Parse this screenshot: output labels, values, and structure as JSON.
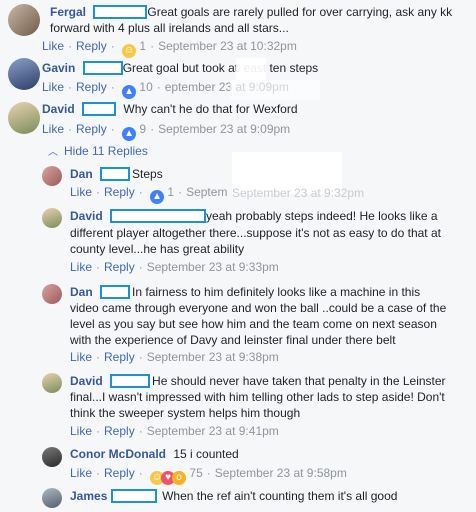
{
  "comments": [
    {
      "name": "Fergal",
      "text1": "Great goals are rarely pulled for over carrying, ask any kk",
      "text2": "forward with 4 plus all irelands and all stars...",
      "like": "Like",
      "reply": "Reply",
      "count": "1",
      "time": "September 23 at 10:32pm"
    },
    {
      "name": "Gavin",
      "text1": "Great goal but took at",
      "text1b": "east ten steps",
      "like": "Like",
      "reply": "Reply",
      "count": "10",
      "time": "September 23 at 9:09pm",
      "time_partial": "eptember 23 at 9:09pm"
    },
    {
      "name": "David",
      "text1": "Why can't he do that for Wexford",
      "like": "Like",
      "reply": "Reply",
      "count": "9",
      "time": "September 23 at 9:09pm"
    }
  ],
  "hide_replies": "Hide 11 Replies",
  "replies": [
    {
      "name": "Dan",
      "text1": "Steps",
      "like": "Like",
      "reply": "Reply",
      "count": "1",
      "time": "September 23 at 9:32pm",
      "time_partial": "Septem"
    },
    {
      "name": "David",
      "text1": "yeah probably steps indeed! He looks like a",
      "text2": "different player altogether there...suppose it's not as easy to do that at",
      "text3": "county level...he has great ability",
      "like": "Like",
      "reply": "Reply",
      "time": "September 23 at 9:33pm"
    },
    {
      "name": "Dan",
      "text1": "In fairness to him definitely looks like a machine in this",
      "text2": "video came through everyone and won the ball ..could be a case of the",
      "text3": "level as you say but see how him and the team come on next season",
      "text4": "with the experience of Davy and leinster final under there belt",
      "like": "Like",
      "reply": "Reply",
      "time": "September 23 at 9:38pm"
    },
    {
      "name": "David",
      "text1": "He should never have taken that penalty in the Leinster",
      "text2": "final...I wasn't impressed with him telling other lads to step aside! Don't",
      "text3": "think the sweeper system helps him though",
      "like": "Like",
      "reply": "Reply",
      "time": "September 23 at 9:41pm"
    },
    {
      "name": "Conor McDonald",
      "text1": "15 i counted",
      "like": "Like",
      "reply": "Reply",
      "count": "75",
      "time": "September 23 at 9:58pm"
    },
    {
      "name": "James",
      "text1": "When the ref ain't counting them it's all good"
    }
  ],
  "colors": {
    "name": "#365899",
    "link": "#4267b2",
    "meta": "#90949c",
    "redaction": "#1e90d6"
  },
  "icons": [
    "like-reaction-icon",
    "haha-reaction-icon",
    "love-reaction-icon",
    "wow-reaction-icon",
    "chevron-up-icon"
  ]
}
